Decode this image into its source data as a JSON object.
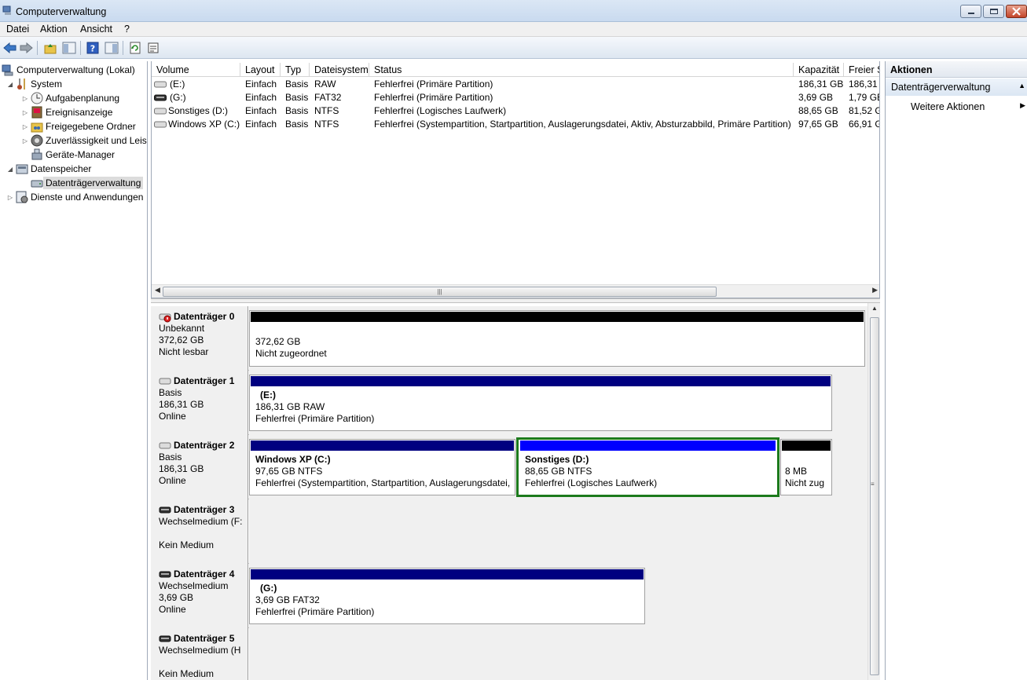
{
  "window": {
    "title": "Computerverwaltung"
  },
  "menu": {
    "items": [
      "Datei",
      "Aktion",
      "Ansicht",
      "?"
    ]
  },
  "tree": {
    "root": "Computerverwaltung (Lokal)",
    "system": "System",
    "aufgaben": "Aufgabenplanung",
    "ereignis": "Ereignisanzeige",
    "freigabe": "Freigegebene Ordner",
    "zuverl": "Zuverlässigkeit und Leis",
    "geraete": "Geräte-Manager",
    "datenspeicher": "Datenspeicher",
    "datentraeger": "Datenträgerverwaltung",
    "dienste": "Dienste und Anwendungen"
  },
  "list": {
    "headers": [
      "Volume",
      "Layout",
      "Typ",
      "Dateisystem",
      "Status",
      "Kapazität",
      "Freier Sp"
    ],
    "rows": [
      [
        "(E:)",
        "Einfach",
        "Basis",
        "RAW",
        "Fehlerfrei (Primäre Partition)",
        "186,31 GB",
        "186,31 C"
      ],
      [
        "(G:)",
        "Einfach",
        "Basis",
        "FAT32",
        "Fehlerfrei (Primäre Partition)",
        "3,69 GB",
        "1,79 GB"
      ],
      [
        "Sonstiges (D:)",
        "Einfach",
        "Basis",
        "NTFS",
        "Fehlerfrei (Logisches Laufwerk)",
        "88,65 GB",
        "81,52 GI"
      ],
      [
        "Windows XP (C:)",
        "Einfach",
        "Basis",
        "NTFS",
        "Fehlerfrei (Systempartition, Startpartition, Auslagerungsdatei, Aktiv, Absturzabbild, Primäre Partition)",
        "97,65 GB",
        "66,91 GI"
      ]
    ]
  },
  "disks": {
    "d0": {
      "name": "Datenträger 0",
      "type": "Unbekannt",
      "size": "372,62 GB",
      "status": "Nicht lesbar",
      "p1": {
        "size": "372,62 GB",
        "status": "Nicht zugeordnet"
      }
    },
    "d1": {
      "name": "Datenträger 1",
      "type": "Basis",
      "size": "186,31 GB",
      "status": "Online",
      "p1": {
        "name": "(E:)",
        "size": "186,31 GB RAW",
        "status": "Fehlerfrei (Primäre Partition)"
      }
    },
    "d2": {
      "name": "Datenträger 2",
      "type": "Basis",
      "size": "186,31 GB",
      "status": "Online",
      "p1": {
        "name": "Windows XP  (C:)",
        "size": "97,65 GB NTFS",
        "status": "Fehlerfrei (Systempartition, Startpartition, Auslagerungsdatei,"
      },
      "p2": {
        "name": "Sonstiges  (D:)",
        "size": "88,65 GB NTFS",
        "status": "Fehlerfrei (Logisches Laufwerk)"
      },
      "p3": {
        "size": "8 MB",
        "status": "Nicht zug"
      }
    },
    "d3": {
      "name": "Datenträger 3",
      "type": "Wechselmedium (F:",
      "status": "Kein Medium"
    },
    "d4": {
      "name": "Datenträger 4",
      "type": "Wechselmedium",
      "size": "3,69 GB",
      "status": "Online",
      "p1": {
        "name": "(G:)",
        "size": "3,69 GB FAT32",
        "status": "Fehlerfrei (Primäre Partition)"
      }
    },
    "d5": {
      "name": "Datenträger 5",
      "type": "Wechselmedium (H",
      "status": "Kein Medium"
    }
  },
  "actions": {
    "title": "Aktionen",
    "section": "Datenträgerverwaltung",
    "more": "Weitere Aktionen"
  },
  "colors": {
    "primary_partition": "#000080",
    "logical_drive": "#0000ff",
    "unallocated": "#000000",
    "selection": "#1c7a1c"
  }
}
